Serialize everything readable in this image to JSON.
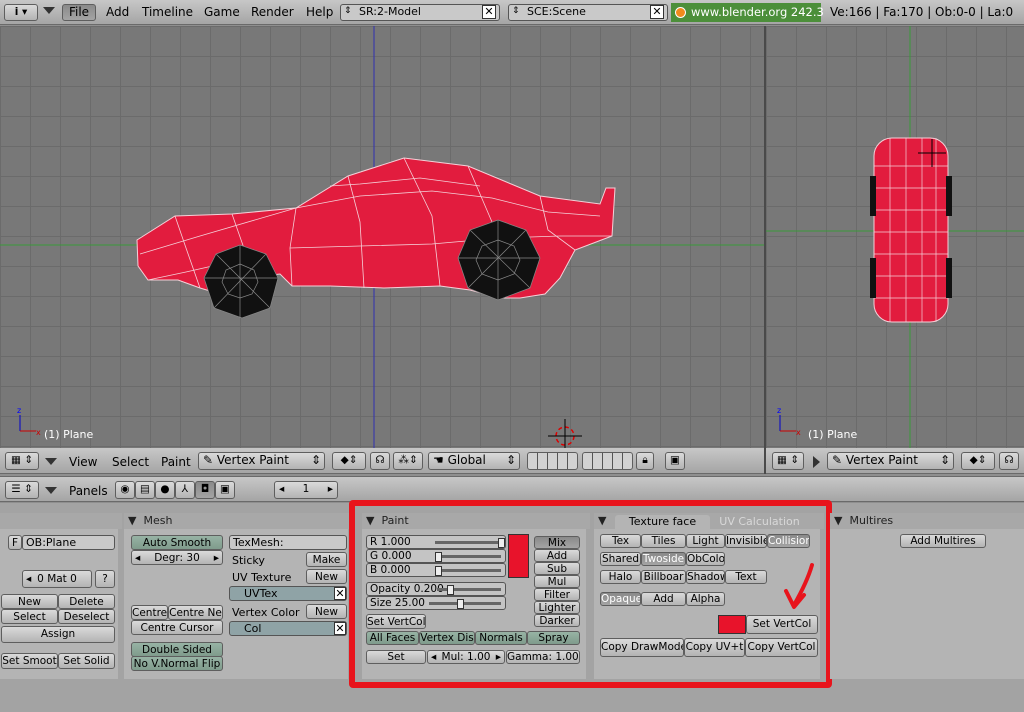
{
  "top": {
    "menus": [
      "File",
      "Add",
      "Timeline",
      "Game",
      "Render",
      "Help"
    ],
    "screen_field": "SR:2-Model",
    "scene_field": "SCE:Scene",
    "url": "www.blender.org 242.3",
    "stats": "Ve:166 | Fa:170 | Ob:0-0 | La:0"
  },
  "viewport_left": {
    "label": "(1) Plane",
    "menus": [
      "View",
      "Select",
      "Paint"
    ],
    "mode": "Vertex Paint",
    "orientation": "Global"
  },
  "viewport_right": {
    "label": "(1) Plane",
    "mode": "Vertex Paint"
  },
  "buttons_header": {
    "label": "Panels",
    "page": "1"
  },
  "link_panel": {
    "f_label": "F",
    "object_name": "OB:Plane",
    "mat_label": "0 Mat 0",
    "help": "?",
    "new": "New",
    "delete": "Delete",
    "select": "Select",
    "deselect": "Deselect",
    "assign": "Assign",
    "set_smooth": "Set Smoot",
    "set_solid": "Set Solid"
  },
  "mesh_panel": {
    "title": "Mesh",
    "auto_smooth": "Auto Smooth",
    "degr": "Degr: 30",
    "texmesh": "TexMesh:",
    "sticky": "Sticky",
    "make": "Make",
    "uv_texture": "UV Texture",
    "new1": "New",
    "uvtex": "UVTex",
    "vertex_color": "Vertex Color",
    "new2": "New",
    "col": "Col",
    "centre": "Centre",
    "centre_new": "Centre Ne",
    "centre_cursor": "Centre Cursor",
    "double_sided": "Double Sided",
    "no_vnormal_flip": "No V.Normal Flip"
  },
  "paint_panel": {
    "title": "Paint",
    "r": "R 1.000",
    "g": "G 0.000",
    "b": "B 0.000",
    "opacity": "Opacity 0.200",
    "size": "Size 25.00",
    "set_vertcol": "Set VertCol",
    "modes": [
      "Mix",
      "Add",
      "Sub",
      "Mul",
      "Filter",
      "Lighter",
      "Darker"
    ],
    "all_faces": "All Faces",
    "vertex_dist": "Vertex Dis",
    "normals": "Normals",
    "spray": "Spray",
    "set": "Set",
    "mul": "Mul: 1.00",
    "gamma": "Gamma: 1.000",
    "color": "#e8132b"
  },
  "texture_face_panel": {
    "tab_active": "Texture face",
    "tab_inactive": "UV Calculation",
    "row1": [
      "Tex",
      "Tiles",
      "Light",
      "Invisible",
      "Collision"
    ],
    "row2": [
      "Shared",
      "Twoside",
      "ObColo"
    ],
    "row3": [
      "Halo",
      "Billboar",
      "Shadow",
      "Text"
    ],
    "row4": [
      "Opaque",
      "Add",
      "Alpha"
    ],
    "set_vertcol": "Set VertCol",
    "copy_drawmode": "Copy DrawMode",
    "copy_uv": "Copy UV+t",
    "copy_vertcol": "Copy VertCol"
  },
  "multires_panel": {
    "title": "Multires",
    "add_multires": "Add Multires"
  },
  "colors": {
    "annotation_red": "#e8141c",
    "car_red": "#e21c3e",
    "url_green": "#4c8f3a"
  }
}
